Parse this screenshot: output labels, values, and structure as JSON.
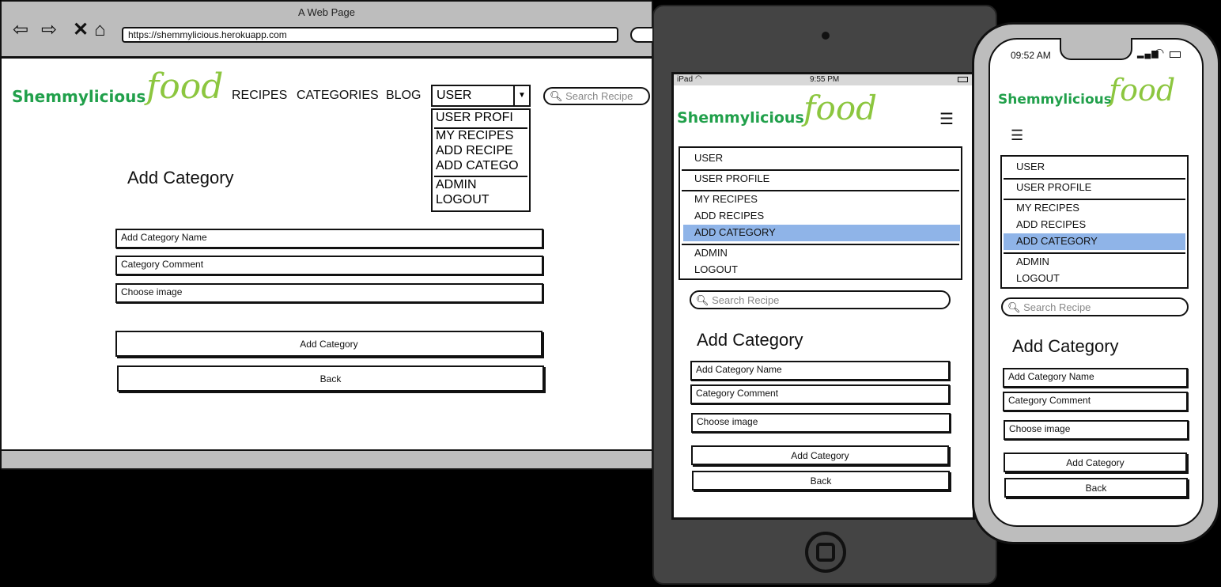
{
  "desktop": {
    "window_title": "A Web Page",
    "url": "https://shemmylicious.herokuapp.com",
    "logo": {
      "main": "Shemmylicious",
      "food": "food"
    },
    "nav": [
      "RECIPES",
      "CATEGORIES",
      "BLOG"
    ],
    "user_select": "USER",
    "dropdown": [
      "USER PROFI",
      "MY RECIPES",
      "ADD RECIPE",
      "ADD CATEGO",
      "ADMIN",
      "LOGOUT"
    ],
    "search_placeholder": "Search Recipe",
    "heading": "Add Category",
    "fields": [
      "Add Category Name",
      "Category Comment",
      "Choose image"
    ],
    "buttons": [
      "Add Category",
      "Back"
    ]
  },
  "tablet": {
    "status": {
      "left": "iPad",
      "time": "9:55 PM"
    },
    "logo": {
      "main": "Shemmylicious",
      "food": "food"
    },
    "menu": [
      "USER",
      "USER PROFILE",
      "MY RECIPES",
      "ADD RECIPES",
      "ADD CATEGORY",
      "ADMIN",
      "LOGOUT"
    ],
    "search_placeholder": "Search Recipe",
    "heading": "Add Category",
    "fields": [
      "Add Category Name",
      "Category Comment",
      "Choose image"
    ],
    "buttons": [
      "Add Category",
      "Back"
    ]
  },
  "phone": {
    "status": {
      "time": "09:52 AM"
    },
    "logo": {
      "main": "Shemmylicious",
      "food": "food"
    },
    "menu": [
      "USER",
      "USER PROFILE",
      "MY RECIPES",
      "ADD RECIPES",
      "ADD CATEGORY",
      "ADMIN",
      "LOGOUT"
    ],
    "search_placeholder": "Search Recipe",
    "heading": "Add Category",
    "fields": [
      "Add Category Name",
      "Category Comment",
      "Choose image"
    ],
    "buttons": [
      "Add Category",
      "Back"
    ]
  },
  "colors": {
    "brand_green": "#21a04b",
    "food_green": "#8cc63f",
    "highlight": "#8fb4e8",
    "frame_gray": "#bdbdbd"
  }
}
